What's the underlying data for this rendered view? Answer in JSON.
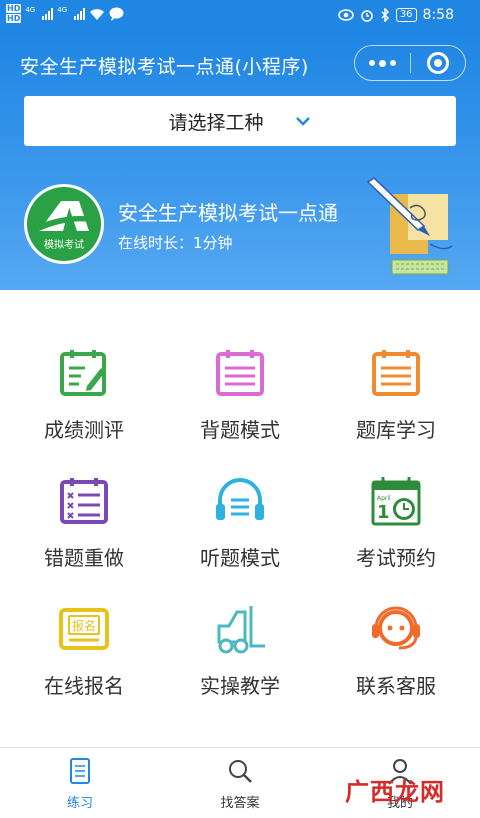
{
  "status_bar": {
    "net_left": "4G",
    "net_right": "4G",
    "battery": "36",
    "time": "8:58"
  },
  "app": {
    "title": "安全生产模拟考试一点通(小程序)"
  },
  "selector": {
    "placeholder": "请选择工种"
  },
  "profile": {
    "logo_caption": "模拟考试",
    "name": "安全生产模拟考试一点通",
    "online_time": "在线时长：1分钟"
  },
  "menu": [
    {
      "label": "成绩测评",
      "icon": "edit-note-icon",
      "color": "#3aa84a"
    },
    {
      "label": "背题模式",
      "icon": "list-note-icon",
      "color": "#d96ad6"
    },
    {
      "label": "题库学习",
      "icon": "list-note-icon",
      "color": "#ef8a2f"
    },
    {
      "label": "错题重做",
      "icon": "wrong-list-icon",
      "color": "#7b48b8"
    },
    {
      "label": "听题模式",
      "icon": "headphones-icon",
      "color": "#2fb1e0"
    },
    {
      "label": "考试预约",
      "icon": "calendar-clock-icon",
      "color": "#2e8b3c"
    },
    {
      "label": "在线报名",
      "icon": "signup-icon",
      "color": "#e8c21b"
    },
    {
      "label": "实操教学",
      "icon": "forklift-icon",
      "color": "#4cb7bf"
    },
    {
      "label": "联系客服",
      "icon": "customer-service-icon",
      "color": "#f06a2a"
    }
  ],
  "tabs": [
    {
      "label": "练习",
      "icon": "practice-icon",
      "active": true
    },
    {
      "label": "找答案",
      "icon": "search-icon",
      "active": false
    },
    {
      "label": "我的",
      "icon": "user-icon",
      "active": false
    }
  ],
  "watermark": {
    "text": "广西龙网"
  },
  "colors": {
    "primary": "#1f86e3",
    "header_end": "#56a8f2"
  }
}
